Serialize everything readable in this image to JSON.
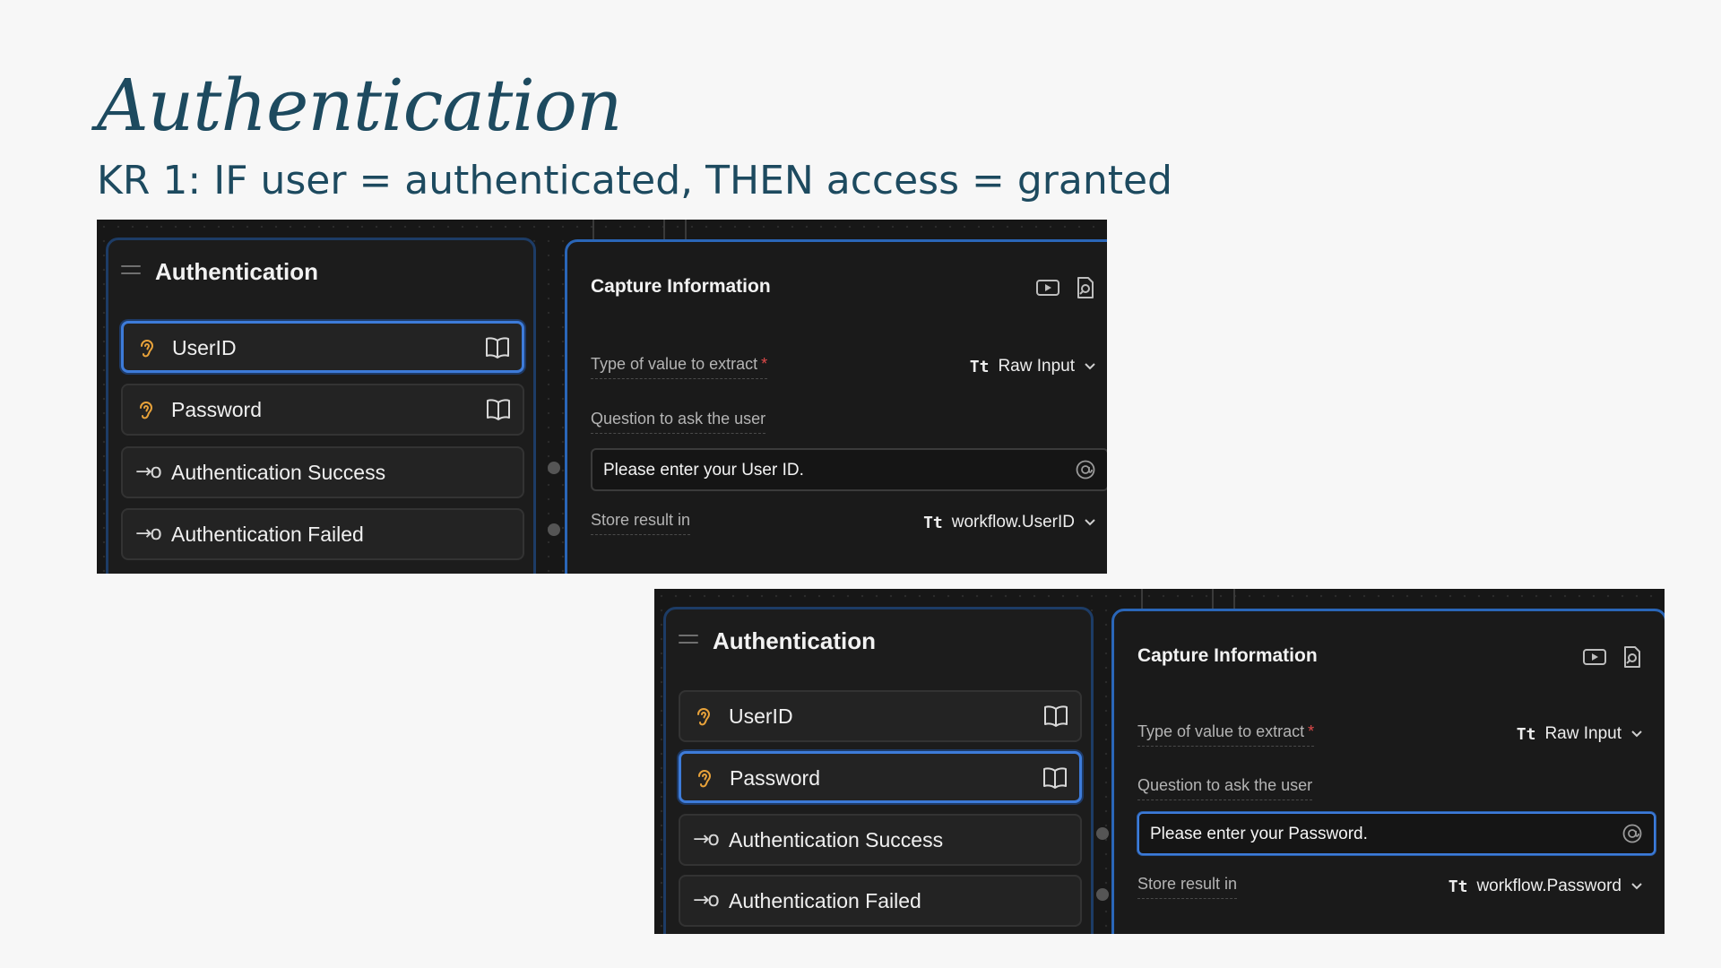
{
  "slide": {
    "title": "Authentication",
    "subtitle": "KR 1: IF user = authenticated, THEN access = granted"
  },
  "screenshots": [
    {
      "node": {
        "title": "Authentication",
        "items": [
          {
            "label": "UserID",
            "icon": "ear-icon",
            "trailing_icon": "book-icon",
            "active": true
          },
          {
            "label": "Password",
            "icon": "ear-icon",
            "trailing_icon": "book-icon",
            "active": false
          },
          {
            "label": "Authentication Success",
            "icon": "arrow-port-icon",
            "active": false
          },
          {
            "label": "Authentication Failed",
            "icon": "arrow-port-icon",
            "active": false
          }
        ]
      },
      "panel": {
        "title": "Capture Information",
        "header_icons": [
          "video-icon",
          "search-doc-icon"
        ],
        "type_label": "Type of value to extract",
        "required_marker": "*",
        "type_prefix": "Tt",
        "type_value": "Raw Input",
        "question_label": "Question to ask the user",
        "question_value": "Please enter your User ID.",
        "store_label": "Store result in",
        "store_prefix": "Tt",
        "store_value": "workflow.UserID"
      }
    },
    {
      "node": {
        "title": "Authentication",
        "items": [
          {
            "label": "UserID",
            "icon": "ear-icon",
            "trailing_icon": "book-icon",
            "active": false
          },
          {
            "label": "Password",
            "icon": "ear-icon",
            "trailing_icon": "book-icon",
            "active": true
          },
          {
            "label": "Authentication Success",
            "icon": "arrow-port-icon",
            "active": false
          },
          {
            "label": "Authentication Failed",
            "icon": "arrow-port-icon",
            "active": false
          }
        ]
      },
      "panel": {
        "title": "Capture Information",
        "header_icons": [
          "video-icon",
          "search-doc-icon"
        ],
        "type_label": "Type of value to extract",
        "required_marker": "*",
        "type_prefix": "Tt",
        "type_value": "Raw Input",
        "question_label": "Question to ask the user",
        "question_value": "Please enter your Password.",
        "store_label": "Store result in",
        "store_prefix": "Tt",
        "store_value": "workflow.Password"
      }
    }
  ],
  "colors": {
    "title": "#1d4a5f",
    "canvas": "#171717",
    "accent_blue": "#3d7bd9",
    "ear_orange": "#e8a23a",
    "required_red": "#e04a4a"
  }
}
